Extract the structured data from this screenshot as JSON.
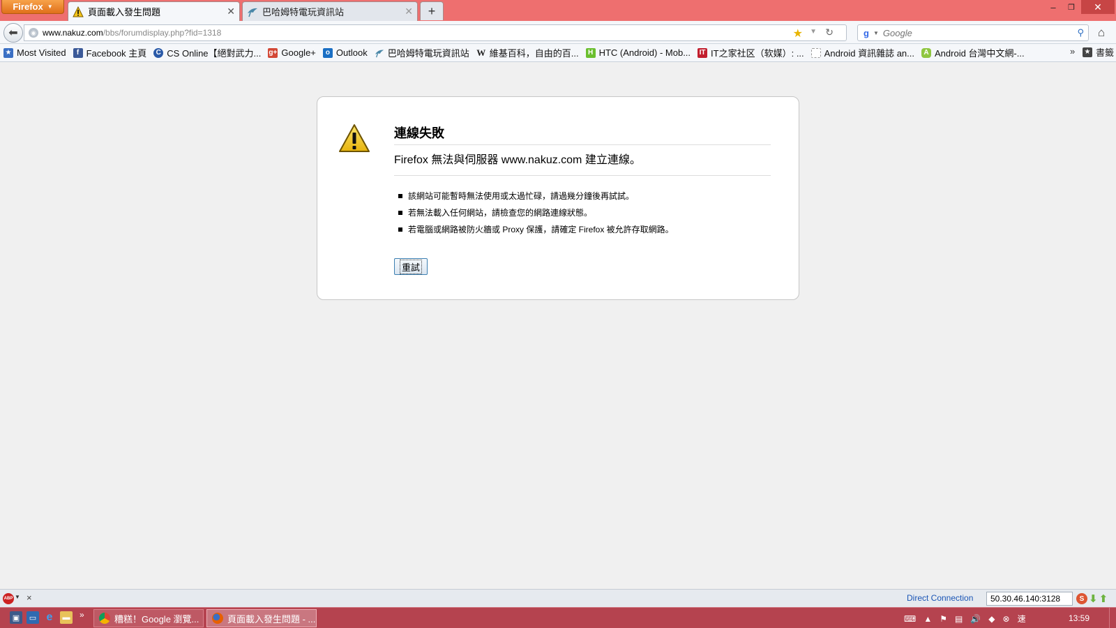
{
  "browser": {
    "menu_label": "Firefox",
    "tabs": [
      {
        "label": "頁面載入發生問題",
        "active": true,
        "icon": "warning-icon"
      },
      {
        "label": "巴哈姆特電玩資訊站",
        "active": false,
        "icon": "gamer-bird-icon"
      }
    ],
    "new_tab_label": "+",
    "window_controls": {
      "minimize": "–",
      "maximize": "❐",
      "close": "✕"
    }
  },
  "navbar": {
    "url_host": "www.nakuz.com",
    "url_path": "/bbs/forumdisplay.php?fid=1318",
    "search_engine": "Google",
    "search_placeholder": "Google"
  },
  "bookmarks": [
    {
      "label": "Most Visited",
      "icon": "most-visited-icon",
      "color": "#3a6fc4"
    },
    {
      "label": "Facebook 主頁",
      "icon": "facebook-icon",
      "color": "#3b5998"
    },
    {
      "label": "CS Online【絕對武力...",
      "icon": "cs-online-icon",
      "color": "#2a5aa8"
    },
    {
      "label": "Google+",
      "icon": "google-plus-icon",
      "color": "#d34836"
    },
    {
      "label": "Outlook",
      "icon": "outlook-icon",
      "color": "#1a6fc4"
    },
    {
      "label": "巴哈姆特電玩資訊站",
      "icon": "gamer-bird-icon",
      "color": "#4a88a8"
    },
    {
      "label": "維基百科，自由的百...",
      "icon": "wikipedia-icon",
      "color": "#555555"
    },
    {
      "label": "HTC (Android) - Mob...",
      "icon": "htc-android-icon",
      "color": "#6bbf2f"
    },
    {
      "label": "IT之家社区（软媒）: ...",
      "icon": "ithome-icon",
      "color": "#c21f2e"
    },
    {
      "label": "Android 資訊雜誌 an...",
      "icon": "blank-page-icon",
      "color": "#bbbbbb"
    },
    {
      "label": "Android 台灣中文網-...",
      "icon": "android-icon",
      "color": "#8fc640"
    }
  ],
  "bookmarks_more": "»",
  "bookmarks_folder": "書籤",
  "error": {
    "title": "連線失敗",
    "message": "Firefox 無法與伺服器 www.nakuz.com 建立連線。",
    "tips": [
      "該網站可能暫時無法使用或太過忙碌，請過幾分鐘後再試試。",
      "若無法載入任何網站，請檢查您的網路連線狀態。",
      "若電腦或網路被防火牆或 Proxy 保護，請確定 Firefox 被允許存取網路。"
    ],
    "retry_label": "重試"
  },
  "statusbar": {
    "abp_label": "ABP",
    "close_label": "×",
    "connection_label": "Direct Connection",
    "proxy_value": "50.30.46.140:3128"
  },
  "taskbar": {
    "tasks": [
      {
        "label": "糟糕！Google 瀏覽...",
        "icon": "chrome-icon",
        "active": false
      },
      {
        "label": "頁面載入發生問題 - ...",
        "icon": "firefox-icon",
        "active": true
      }
    ],
    "clock": "13:59",
    "chevron": "»"
  },
  "colors": {
    "titlebar": "#ee6f6f",
    "taskbar": "#b5434f",
    "accent_link": "#1a55b5",
    "firefox_orange": "#e0701a"
  }
}
